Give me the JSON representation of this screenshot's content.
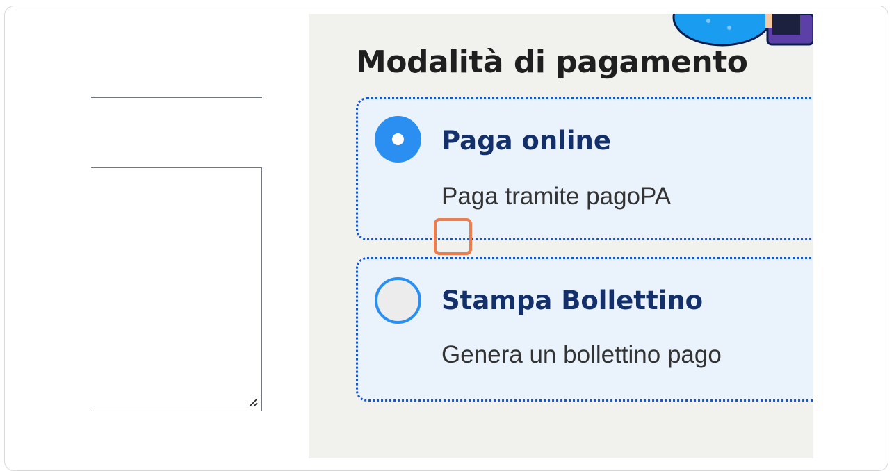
{
  "payment": {
    "title": "Modalità di pagamento",
    "options": [
      {
        "label": "Paga online",
        "description": "Paga tramite pagoPA",
        "selected": true
      },
      {
        "label": "Stampa Bollettino",
        "description": "Genera un bollettino pago",
        "selected": false
      }
    ]
  },
  "colors": {
    "accent": "#2a8ff0",
    "label": "#14306b",
    "option_border": "#1a55c9",
    "option_bg": "#eaf3fc",
    "highlight": "#ef7d4c"
  },
  "icons": {
    "resize": "resize-handle-icon",
    "illustration": "payment-illustration"
  }
}
